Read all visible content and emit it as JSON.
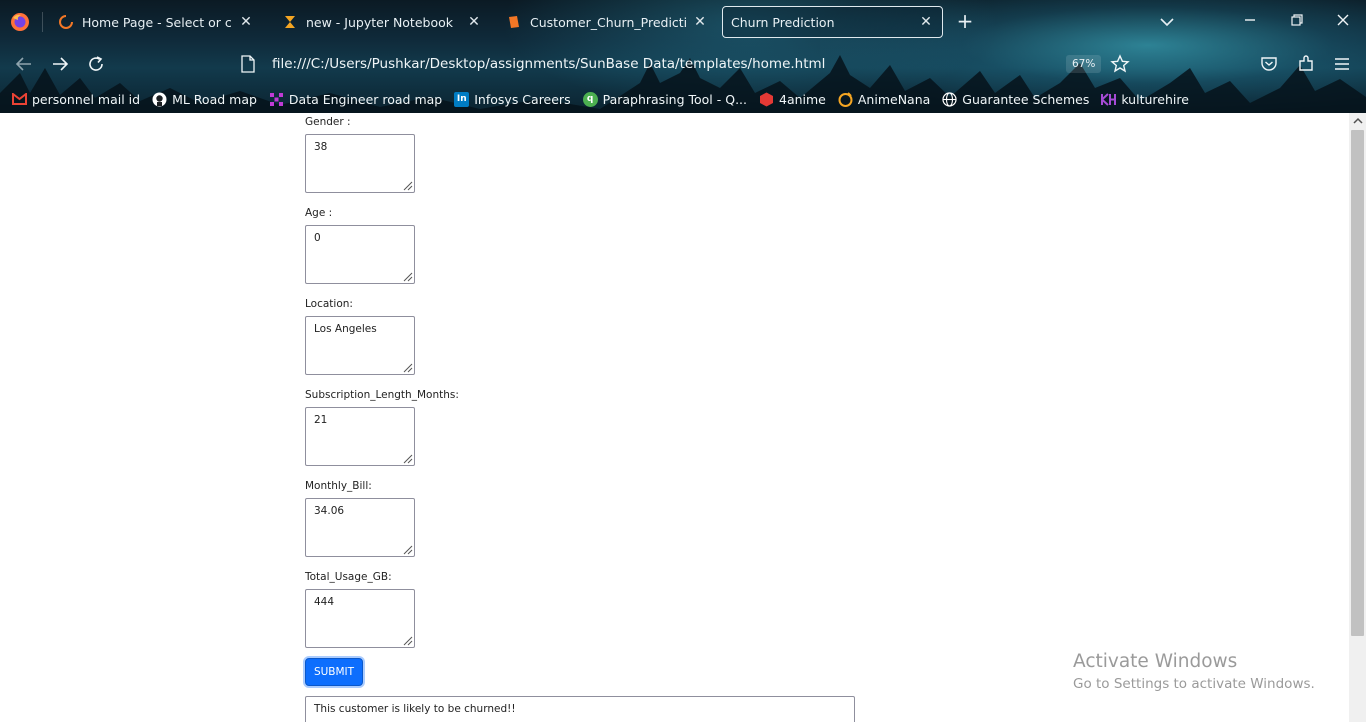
{
  "browser": {
    "tabs": [
      {
        "title": "Home Page - Select or create a",
        "icon": "jupyter-spinner-icon",
        "active": false
      },
      {
        "title": "new - Jupyter Notebook",
        "icon": "hourglass-icon",
        "active": false
      },
      {
        "title": "Customer_Churn_Prediction_As",
        "icon": "notebook-icon",
        "active": false
      },
      {
        "title": "Churn Prediction",
        "icon": "",
        "active": true
      }
    ],
    "new_tab_label": "+",
    "url": "file:///C:/Users/Pushkar/Desktop/assignments/SunBase Data/templates/home.html",
    "zoom": "67%",
    "bookmarks": [
      {
        "label": "personnel mail id",
        "icon": "gmail-icon",
        "color": "#ea4335"
      },
      {
        "label": "ML Road map",
        "icon": "github-icon",
        "color": "#ffffff"
      },
      {
        "label": "Data Engineer road map",
        "icon": "grid-icon",
        "color": "#c03bd6"
      },
      {
        "label": "Infosys Careers",
        "icon": "infosys-icon",
        "color": "#007cc3"
      },
      {
        "label": "Paraphrasing Tool - Q...",
        "icon": "quillbot-icon",
        "color": "#4caf50"
      },
      {
        "label": "4anime",
        "icon": "4anime-icon",
        "color": "#e53935"
      },
      {
        "label": "AnimeNana",
        "icon": "animenana-icon",
        "color": "#f5a623"
      },
      {
        "label": "Guarantee Schemes",
        "icon": "globe-icon",
        "color": "#ffffff"
      },
      {
        "label": "kulturehire",
        "icon": "kulturehire-icon",
        "color": "#8e44ad"
      }
    ]
  },
  "form": {
    "fields": [
      {
        "label": "Gender :",
        "value": "38"
      },
      {
        "label": "Age :",
        "value": "0"
      },
      {
        "label": "Location:",
        "value": "Los Angeles"
      },
      {
        "label": "Subscription_Length_Months:",
        "value": "21"
      },
      {
        "label": "Monthly_Bill:",
        "value": "34.06"
      },
      {
        "label": "Total_Usage_GB:",
        "value": "444"
      }
    ],
    "submit_label": "SUBMIT",
    "result": "This customer is likely to be churned!!"
  },
  "watermark": {
    "title": "Activate Windows",
    "subtitle": "Go to Settings to activate Windows."
  },
  "colors": {
    "accent": "#0d6efd",
    "chrome_bg": "#0f2a3a"
  }
}
